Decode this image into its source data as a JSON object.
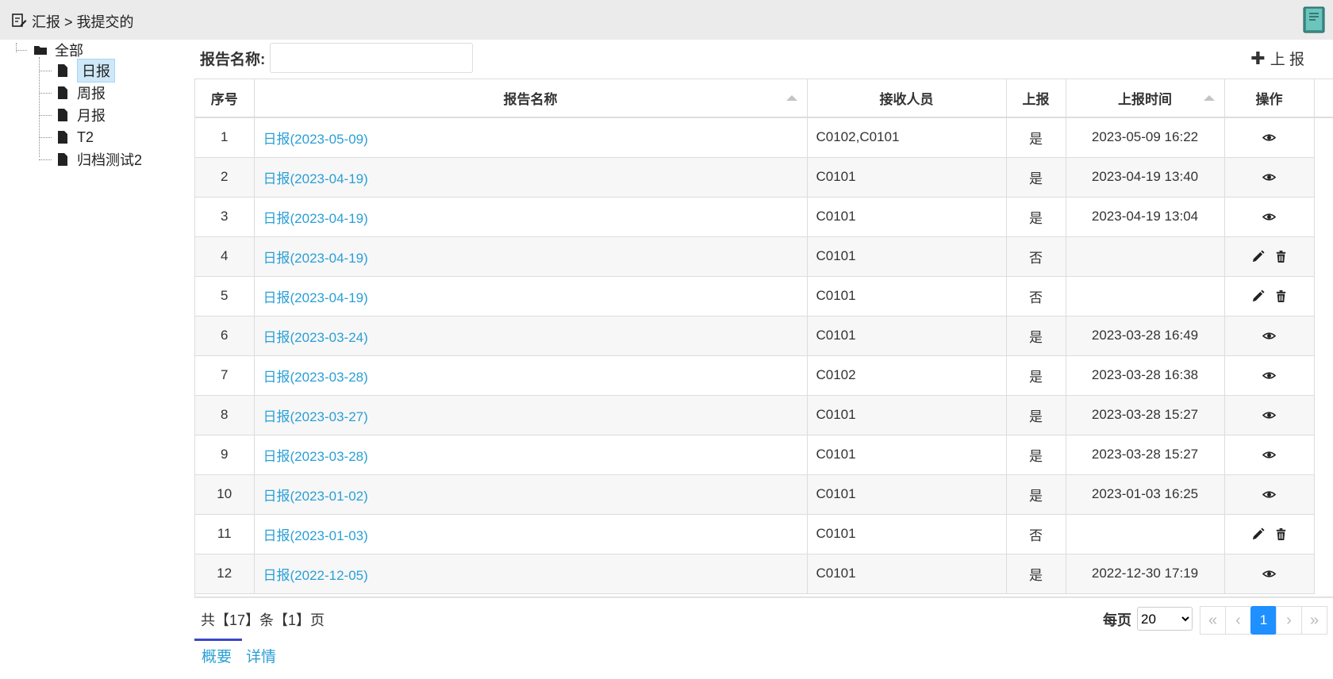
{
  "header": {
    "breadcrumb": "汇报 > 我提交的",
    "icons": {
      "breadcrumb": "edit-document-icon",
      "right": "book-icon"
    }
  },
  "tree": {
    "root": "全部",
    "items": [
      "日报",
      "周报",
      "月报",
      "T2",
      "归档测试2"
    ],
    "selected": "日报"
  },
  "search": {
    "label": "报告名称:",
    "value": "",
    "placeholder": ""
  },
  "toolbar": {
    "report_label": "上 报"
  },
  "table": {
    "columns": [
      "序号",
      "报告名称",
      "接收人员",
      "上报",
      "上报时间",
      "操作"
    ],
    "rows": [
      {
        "no": "1",
        "name": "日报(2023-05-09)",
        "receiver": "C0102,C0101",
        "reported": "是",
        "time": "2023-05-09 16:22",
        "ops": [
          "view"
        ]
      },
      {
        "no": "2",
        "name": "日报(2023-04-19)",
        "receiver": "C0101",
        "reported": "是",
        "time": "2023-04-19 13:40",
        "ops": [
          "view"
        ]
      },
      {
        "no": "3",
        "name": "日报(2023-04-19)",
        "receiver": "C0101",
        "reported": "是",
        "time": "2023-04-19 13:04",
        "ops": [
          "view"
        ]
      },
      {
        "no": "4",
        "name": "日报(2023-04-19)",
        "receiver": "C0101",
        "reported": "否",
        "time": "",
        "ops": [
          "edit",
          "delete"
        ]
      },
      {
        "no": "5",
        "name": "日报(2023-04-19)",
        "receiver": "C0101",
        "reported": "否",
        "time": "",
        "ops": [
          "edit",
          "delete"
        ]
      },
      {
        "no": "6",
        "name": "日报(2023-03-24)",
        "receiver": "C0101",
        "reported": "是",
        "time": "2023-03-28 16:49",
        "ops": [
          "view"
        ]
      },
      {
        "no": "7",
        "name": "日报(2023-03-28)",
        "receiver": "C0102",
        "reported": "是",
        "time": "2023-03-28 16:38",
        "ops": [
          "view"
        ]
      },
      {
        "no": "8",
        "name": "日报(2023-03-27)",
        "receiver": "C0101",
        "reported": "是",
        "time": "2023-03-28 15:27",
        "ops": [
          "view"
        ]
      },
      {
        "no": "9",
        "name": "日报(2023-03-28)",
        "receiver": "C0101",
        "reported": "是",
        "time": "2023-03-28 15:27",
        "ops": [
          "view"
        ]
      },
      {
        "no": "10",
        "name": "日报(2023-01-02)",
        "receiver": "C0101",
        "reported": "是",
        "time": "2023-01-03 16:25",
        "ops": [
          "view"
        ]
      },
      {
        "no": "11",
        "name": "日报(2023-01-03)",
        "receiver": "C0101",
        "reported": "否",
        "time": "",
        "ops": [
          "edit",
          "delete"
        ]
      },
      {
        "no": "12",
        "name": "日报(2022-12-05)",
        "receiver": "C0101",
        "reported": "是",
        "time": "2022-12-30 17:19",
        "ops": [
          "view"
        ]
      }
    ]
  },
  "pager": {
    "total_text": "共【17】条【1】页",
    "per_page_label": "每页",
    "per_page_value": "20",
    "current_page": "1",
    "first": "«",
    "prev": "‹",
    "next": "›",
    "last": "»"
  },
  "bottom_tabs": [
    "概要",
    "详情"
  ],
  "colors": {
    "link": "#2a9fd6",
    "active_page": "#1e90ff",
    "tab_indicator": "#3c48c9",
    "selected_node": "#cfe8f8"
  }
}
